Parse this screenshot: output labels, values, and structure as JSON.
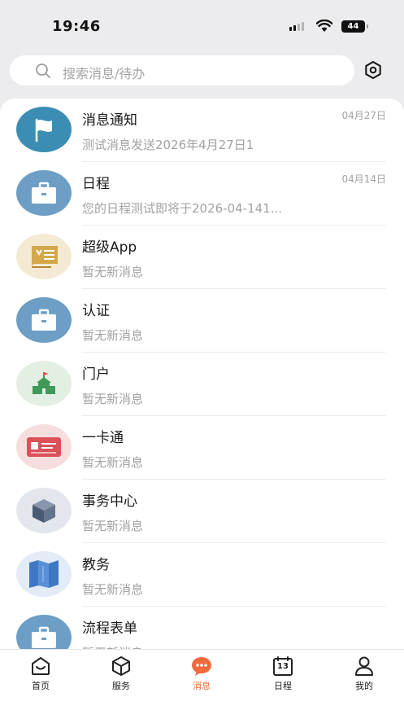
{
  "status_bar": {
    "time": "19:46",
    "battery": "44"
  },
  "search": {
    "placeholder": "搜索消息/待办"
  },
  "messages": [
    {
      "title": "消息通知",
      "subtitle": "测试消息发送2026年4月27日1",
      "date": "04月27日",
      "icon": "flag-icon"
    },
    {
      "title": "日程",
      "subtitle": "您的日程测试即将于2026-04-141...",
      "date": "04月14日",
      "icon": "briefcase-icon"
    },
    {
      "title": "超级App",
      "subtitle": "暂无新消息",
      "date": "",
      "icon": "certificate-icon"
    },
    {
      "title": "认证",
      "subtitle": "暂无新消息",
      "date": "",
      "icon": "briefcase-icon"
    },
    {
      "title": "门户",
      "subtitle": "暂无新消息",
      "date": "",
      "icon": "school-building-icon"
    },
    {
      "title": "一卡通",
      "subtitle": "暂无新消息",
      "date": "",
      "icon": "id-card-icon"
    },
    {
      "title": "事务中心",
      "subtitle": "暂无新消息",
      "date": "",
      "icon": "cube-icon"
    },
    {
      "title": "教务",
      "subtitle": "暂无新消息",
      "date": "",
      "icon": "folded-map-icon"
    },
    {
      "title": "流程表单",
      "subtitle": "暂无新消息",
      "date": "",
      "icon": "briefcase-icon"
    }
  ],
  "tabs": [
    {
      "label": "首页",
      "icon": "home-icon",
      "active": false
    },
    {
      "label": "服务",
      "icon": "cube-outline-icon",
      "active": false
    },
    {
      "label": "消息",
      "icon": "chat-bubble-icon",
      "active": true
    },
    {
      "label": "日程",
      "icon": "calendar-icon",
      "active": false,
      "badge": "13"
    },
    {
      "label": "我的",
      "icon": "person-icon",
      "active": false
    }
  ],
  "colors": {
    "accent": "#f26a3b",
    "flag_bg": "#3b8db4",
    "briefcase_bg": "#6d9fc6"
  }
}
